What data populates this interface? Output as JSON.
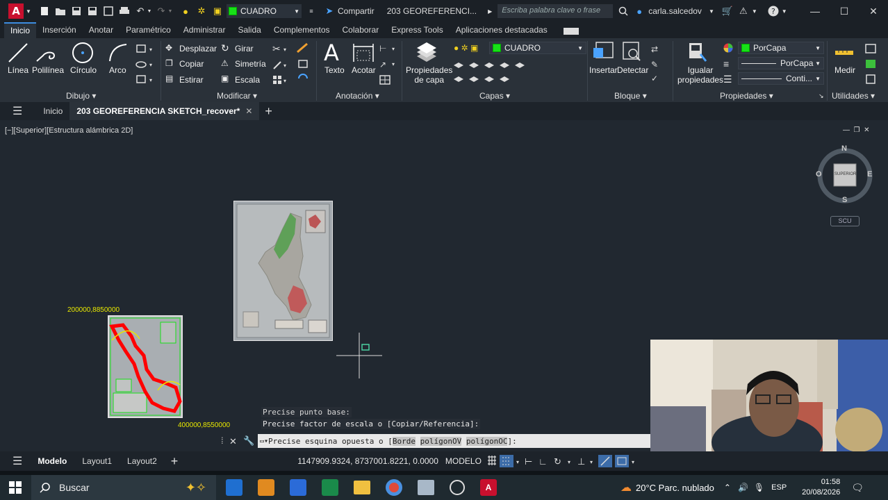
{
  "titlebar": {
    "layer_name": "CUADRO",
    "share_label": "Compartir",
    "doc_title": "203 GEOREFERENCI...",
    "search_placeholder": "Escriba palabra clave o frase",
    "user": "carla.salcedov"
  },
  "tabs": [
    "Inicio",
    "Inserción",
    "Anotar",
    "Paramétrico",
    "Administrar",
    "Salida",
    "Complementos",
    "Colaborar",
    "Express Tools",
    "Aplicaciones destacadas"
  ],
  "ribbon": {
    "draw": {
      "line": "Línea",
      "polyline": "Polilínea",
      "circle": "Círculo",
      "arc": "Arco",
      "group": "Dibujo"
    },
    "modify": {
      "move": "Desplazar",
      "rotate": "Girar",
      "copy": "Copiar",
      "mirror": "Simetría",
      "stretch": "Estirar",
      "scale": "Escala",
      "group": "Modificar"
    },
    "annotation": {
      "text": "Texto",
      "dim": "Acotar",
      "group": "Anotación"
    },
    "layers": {
      "props_line1": "Propiedades",
      "props_line2": "de capa",
      "layer": "CUADRO",
      "group": "Capas"
    },
    "block": {
      "insert": "Insertar",
      "detect": "Detectar",
      "group": "Bloque"
    },
    "properties": {
      "match_line1": "Igualar",
      "match_line2": "propiedades",
      "color": "PorCapa",
      "lineweight": "PorCapa",
      "linetype": "Conti...",
      "group": "Propiedades"
    },
    "utilities": {
      "measure": "Medir",
      "group": "Utilidades"
    }
  },
  "docbar": {
    "home": "Inicio",
    "active": "203 GEOREFERENCIA SKETCH_recover*"
  },
  "viewport": {
    "label": "[−][Superior][Estructura alámbrica 2D]",
    "coord_top": "200000,8850000",
    "coord_bottom": "400000,8550000",
    "compass": {
      "n": "N",
      "s": "S",
      "e": "E",
      "w": "O",
      "top": "SUPERIOR",
      "ucs": "SCU"
    }
  },
  "command": {
    "history": [
      "Precise punto base:",
      "Precise factor de escala o [Copiar/Referencia]:"
    ],
    "prompt_prefix": "Precise esquina opuesta o [",
    "opt1": "Borde",
    "opt2": "polígonOV",
    "opt3": "polígonOC",
    "prompt_suffix": "]:"
  },
  "status": {
    "layouts": [
      "Modelo",
      "Layout1",
      "Layout2"
    ],
    "coords": "1147909.9324, 8737001.8221, 0.0000",
    "mode": "MODELO"
  },
  "taskbar": {
    "search": "Buscar",
    "weather": "20°C  Parc. nublado",
    "lang": "ESP",
    "time": "01:58",
    "date": "20/08/2026"
  },
  "colors": {
    "accent": "#3c8ce0",
    "brand": "#c8102e",
    "layer_green": "#18e018",
    "coord_yellow": "#e8e800"
  }
}
